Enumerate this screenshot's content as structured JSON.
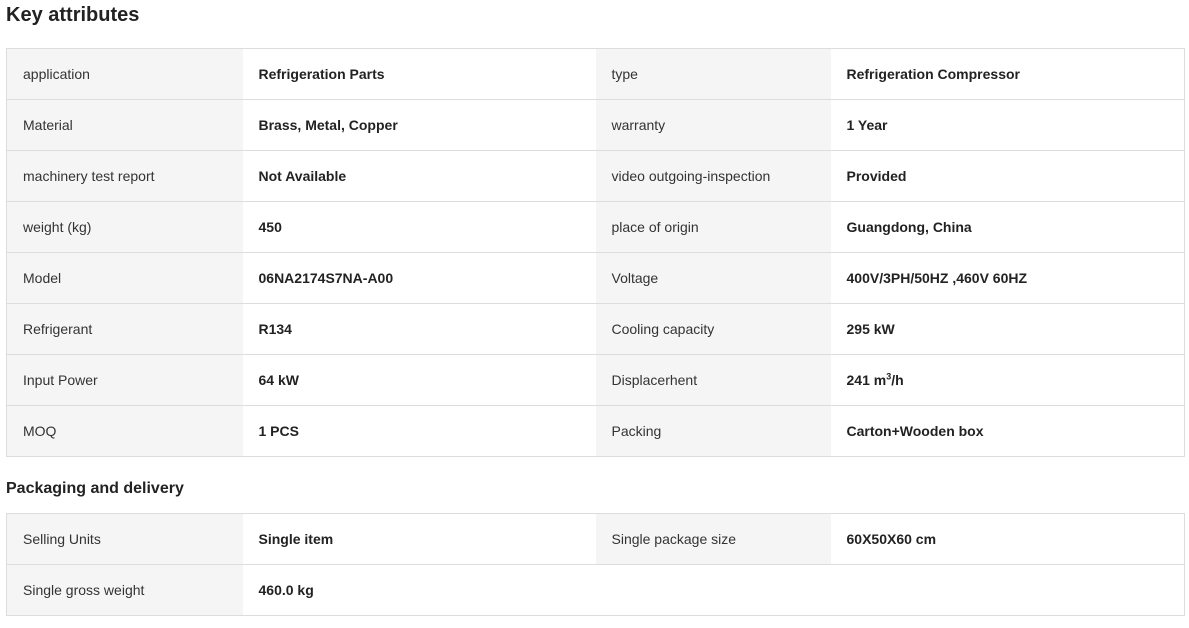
{
  "key_attributes": {
    "title": "Key attributes",
    "rows": [
      {
        "k1": "application",
        "v1": "Refrigeration Parts",
        "k2": "type",
        "v2": "Refrigeration Compressor"
      },
      {
        "k1": "Material",
        "v1": "Brass, Metal, Copper",
        "k2": "warranty",
        "v2": "1 Year"
      },
      {
        "k1": "machinery test report",
        "v1": "Not Available",
        "k2": "video outgoing-inspection",
        "v2": "Provided"
      },
      {
        "k1": "weight (kg)",
        "v1": "450",
        "k2": "place of origin",
        "v2": "Guangdong, China"
      },
      {
        "k1": "Model",
        "v1": "06NA2174S7NA-A00",
        "k2": "Voltage",
        "v2": "400V/3PH/50HZ ,460V 60HZ"
      },
      {
        "k1": "Refrigerant",
        "v1": "R134",
        "k2": "Cooling capacity",
        "v2": "295 kW"
      },
      {
        "k1": "Input Power",
        "v1": "64 kW",
        "k2": "Displacerhent",
        "v2_prefix": "241 m",
        "v2_sup": "3",
        "v2_suffix": "/h"
      },
      {
        "k1": "MOQ",
        "v1": "1 PCS",
        "k2": "Packing",
        "v2": "Carton+Wooden box"
      }
    ]
  },
  "packaging": {
    "title": "Packaging and delivery",
    "rows": [
      {
        "k1": "Selling Units",
        "v1": "Single item",
        "k2": "Single package size",
        "v2": "60X50X60 cm"
      },
      {
        "k1": "Single gross weight",
        "v1": "460.0 kg",
        "k2": "",
        "v2": ""
      }
    ]
  }
}
